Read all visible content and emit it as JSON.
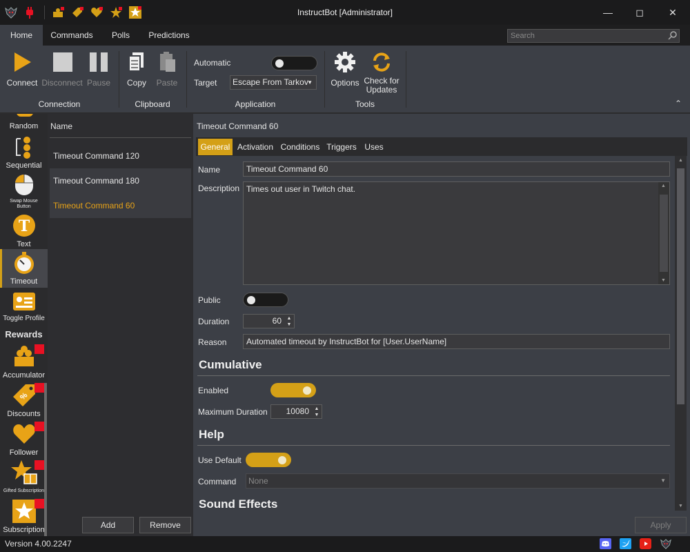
{
  "window": {
    "title": "InstructBot [Administrator]"
  },
  "ribbon_tabs": [
    "Home",
    "Commands",
    "Polls",
    "Predictions"
  ],
  "search": {
    "placeholder": "Search"
  },
  "ribbon": {
    "connect": "Connect",
    "disconnect": "Disconnect",
    "pause": "Pause",
    "copy": "Copy",
    "paste": "Paste",
    "automatic": "Automatic",
    "target": "Target",
    "target_value": "Escape From Tarkov",
    "options": "Options",
    "check_updates_1": "Check for",
    "check_updates_2": "Updates",
    "groups": {
      "connection": "Connection",
      "clipboard": "Clipboard",
      "application": "Application",
      "tools": "Tools"
    }
  },
  "sidebar": {
    "random": "Random",
    "sequential": "Sequential",
    "swap_mouse_1": "Swap Mouse",
    "swap_mouse_2": "Button",
    "text": "Text",
    "timeout": "Timeout",
    "toggle_profile": "Toggle Profile",
    "rewards_header": "Rewards",
    "accumulator": "Accumulator",
    "discounts": "Discounts",
    "follower": "Follower",
    "gifted_subscription": "Gifted Subscription",
    "subscription": "Subscription"
  },
  "list": {
    "header": "Name",
    "items": [
      "Timeout Command 120",
      "Timeout Command 180",
      "Timeout Command 60"
    ],
    "add": "Add",
    "remove": "Remove"
  },
  "detail": {
    "title": "Timeout Command 60",
    "tabs": [
      "General",
      "Activation",
      "Conditions",
      "Triggers",
      "Uses"
    ],
    "name_label": "Name",
    "name_value": "Timeout Command 60",
    "description_label": "Description",
    "description_value": "Times out user in Twitch chat.",
    "public_label": "Public",
    "duration_label": "Duration",
    "duration_value": "60",
    "reason_label": "Reason",
    "reason_value": "Automated timeout by InstructBot for [User.UserName]",
    "cumulative_header": "Cumulative",
    "enabled_label": "Enabled",
    "max_duration_label": "Maximum Duration",
    "max_duration_value": "10080",
    "help_header": "Help",
    "use_default_label": "Use Default",
    "command_label": "Command",
    "command_value": "None",
    "sound_effects_header": "Sound Effects",
    "apply": "Apply"
  },
  "toggles": {
    "automatic": false,
    "public": false,
    "enabled": true,
    "use_default": true
  },
  "status": {
    "version": "Version 4.00.2247"
  },
  "colors": {
    "accent": "#d4a017",
    "background": "#3c3f46",
    "red_badge": "#e81123"
  }
}
